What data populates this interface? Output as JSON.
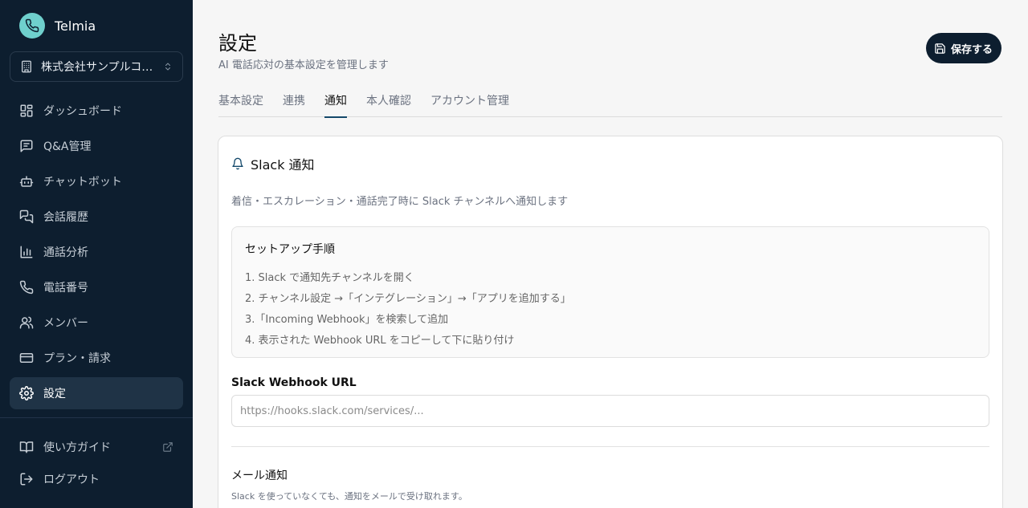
{
  "brand": {
    "name": "Telmia",
    "logo_color": "#6fd0cd"
  },
  "org": {
    "name": "株式会社サンプルコ…"
  },
  "sidebar": {
    "items": [
      {
        "label": "ダッシュボード",
        "icon": "dashboard-icon"
      },
      {
        "label": "Q&A管理",
        "icon": "qa-icon"
      },
      {
        "label": "チャットボット",
        "icon": "bot-icon"
      },
      {
        "label": "会話履歴",
        "icon": "chat-history-icon"
      },
      {
        "label": "通話分析",
        "icon": "chart-icon"
      },
      {
        "label": "電話番号",
        "icon": "phone-icon"
      },
      {
        "label": "メンバー",
        "icon": "users-icon"
      },
      {
        "label": "プラン・請求",
        "icon": "card-icon"
      },
      {
        "label": "設定",
        "icon": "gear-icon",
        "active": true
      }
    ],
    "guide_label": "使い方ガイド",
    "logout_label": "ログアウト"
  },
  "header": {
    "title": "設定",
    "subtitle": "AI 電話応対の基本設定を管理します",
    "save_label": "保存する"
  },
  "tabs": [
    {
      "label": "基本設定"
    },
    {
      "label": "連携"
    },
    {
      "label": "通知",
      "active": true
    },
    {
      "label": "本人確認"
    },
    {
      "label": "アカウント管理"
    }
  ],
  "slack": {
    "title": "Slack 通知",
    "description": "着信・エスカレーション・通話完了時に Slack チャンネルへ通知します",
    "setup_title": "セットアップ手順",
    "steps": [
      "1. Slack で通知先チャンネルを開く",
      "2. チャンネル設定 →「インテグレーション」→「アプリを追加する」",
      "3.「Incoming Webhook」を検索して追加",
      "4. 表示された Webhook URL をコピーして下に貼り付け"
    ],
    "webhook_label": "Slack Webhook URL",
    "webhook_placeholder": "https://hooks.slack.com/services/...",
    "webhook_value": ""
  },
  "mail": {
    "title": "メール通知",
    "description": "Slack を使っていなくても、通知をメールで受け取れます。"
  },
  "colors": {
    "sidebar_bg": "#0d1e2f",
    "active_tab": "#13486a",
    "accent": "#6fd0cd"
  }
}
